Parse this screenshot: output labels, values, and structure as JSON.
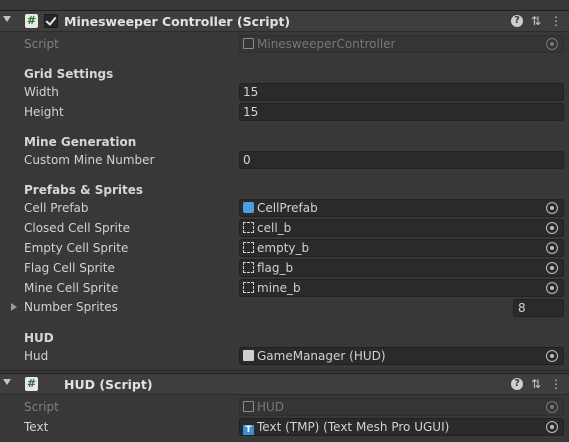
{
  "components": [
    {
      "title": "Minesweeper Controller (Script)",
      "enabled": true,
      "script_label": "Script",
      "script_value": "MinesweeperController",
      "sections": {
        "grid": {
          "title": "Grid Settings",
          "width_label": "Width",
          "width_value": "15",
          "height_label": "Height",
          "height_value": "15"
        },
        "mine": {
          "title": "Mine Generation",
          "custom_label": "Custom Mine Number",
          "custom_value": "0"
        },
        "prefabs": {
          "title": "Prefabs & Sprites",
          "cell_prefab_label": "Cell Prefab",
          "cell_prefab_value": "CellPrefab",
          "closed_label": "Closed Cell Sprite",
          "closed_value": "cell_b",
          "empty_label": "Empty Cell Sprite",
          "empty_value": "empty_b",
          "flag_label": "Flag Cell Sprite",
          "flag_value": "flag_b",
          "mine_label": "Mine Cell Sprite",
          "mine_value": "mine_b",
          "number_label": "Number Sprites",
          "number_value": "8"
        },
        "hud": {
          "title": "HUD",
          "hud_label": "Hud",
          "hud_value": "GameManager (HUD)"
        }
      }
    },
    {
      "title": "HUD (Script)",
      "script_label": "Script",
      "script_value": "HUD",
      "text_label": "Text",
      "text_value": "Text (TMP) (Text Mesh Pro UGUI)"
    }
  ],
  "icons": {
    "help": "help-icon",
    "presets": "presets-icon",
    "menu": "kebab-menu-icon"
  },
  "colors": {
    "background": "#383838",
    "field": "#2a2a2a",
    "prefab_icon": "#4aa0e0",
    "text_icon": "#3a8fd6"
  }
}
